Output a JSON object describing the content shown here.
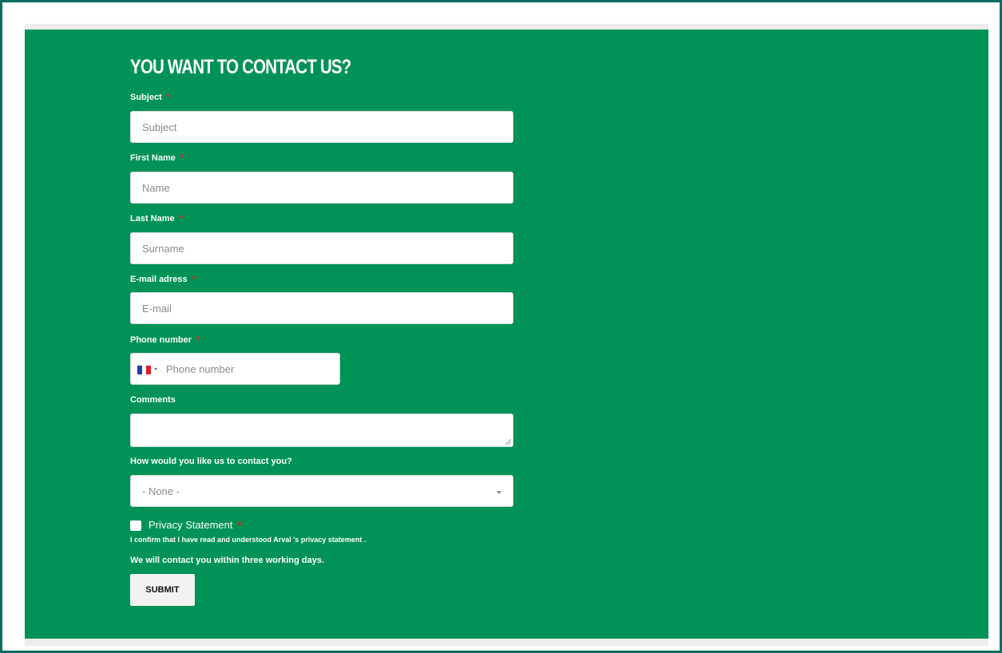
{
  "form": {
    "title": "YOU WANT TO CONTACT US?",
    "required_marker": "*",
    "subject": {
      "label": "Subject",
      "placeholder": "Subject"
    },
    "first_name": {
      "label": "First Name",
      "placeholder": "Name"
    },
    "last_name": {
      "label": "Last Name",
      "placeholder": "Surname"
    },
    "email": {
      "label": "E-mail adress",
      "placeholder": "E-mail"
    },
    "phone": {
      "label": "Phone number",
      "placeholder": "Phone number",
      "country_flag": "france-flag-icon"
    },
    "comments": {
      "label": "Comments"
    },
    "contact_method": {
      "label": "How would you like us to contact you?",
      "selected": "- None -"
    },
    "privacy": {
      "label": "Privacy Statement",
      "confirm_text": "I confirm that I have read and understood Arval 's  privacy statement .",
      "checked": false
    },
    "notice": "We will contact you within three working days.",
    "submit_label": "SUBMIT"
  },
  "colors": {
    "panel_background": "#009257",
    "frame_border": "#0c6e63",
    "required_marker": "#e0201f"
  }
}
